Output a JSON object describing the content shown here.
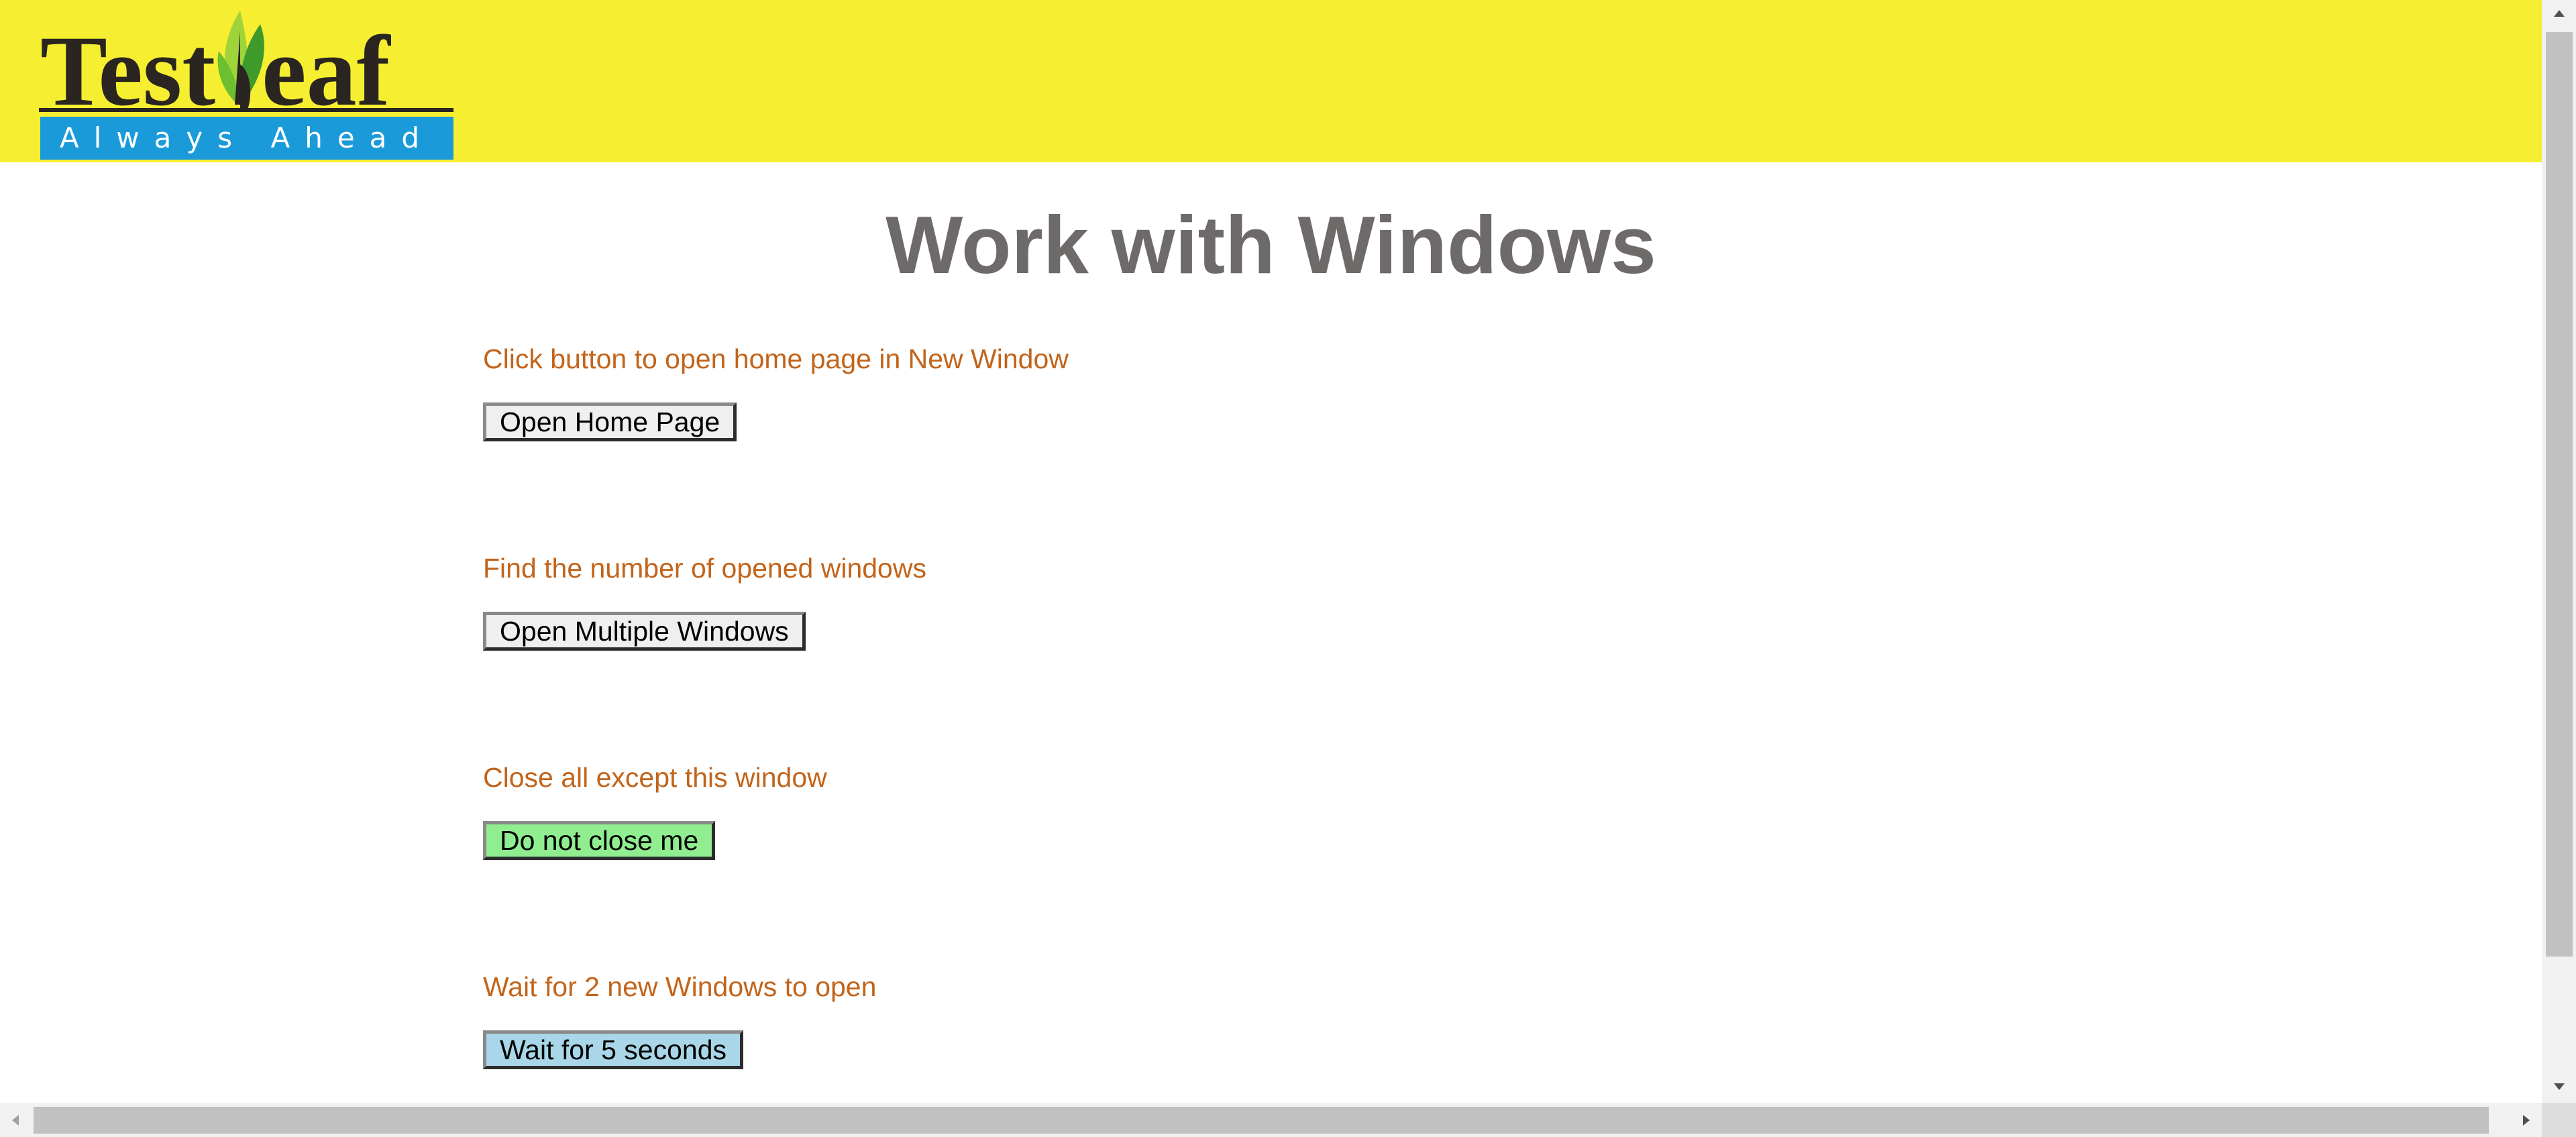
{
  "header": {
    "logo": {
      "wordmark": "TestLeaf",
      "tagline": "Always Ahead",
      "colors": {
        "wordmark": "#2a2520",
        "tagline_bg": "#1a9ad9",
        "tagline_text": "#ffffff",
        "leaf_light": "#9fd33a",
        "leaf_dark": "#3f9a2c"
      }
    },
    "background": "#f6ef31"
  },
  "page": {
    "title": "Work with Windows"
  },
  "sections": [
    {
      "label": "Click button to open home page in New Window",
      "button": "Open Home Page"
    },
    {
      "label": "Find the number of opened windows",
      "button": "Open Multiple Windows"
    },
    {
      "label": "Close all except this window",
      "button": "Do not close me"
    },
    {
      "label": "Wait for 2 new Windows to open",
      "button": "Wait for 5 seconds"
    }
  ],
  "colors": {
    "title": "#6e6a6a",
    "label": "#c2641a",
    "button_default": "#efefef",
    "button_green": "#90ee90",
    "button_blue": "#a9d6e8"
  },
  "icons": {
    "scroll_up": "triangle-up-icon",
    "scroll_down": "triangle-down-icon",
    "scroll_left": "triangle-left-icon",
    "scroll_right": "triangle-right-icon"
  }
}
